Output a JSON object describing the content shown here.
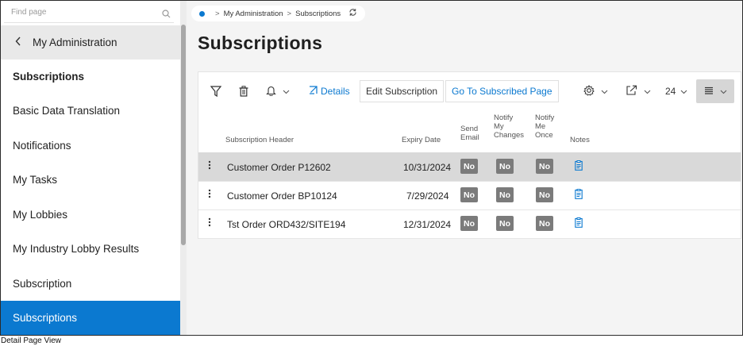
{
  "sidebar": {
    "search_placeholder": "Find page",
    "back_label": "My Administration",
    "items": [
      {
        "label": "Subscriptions"
      },
      {
        "label": "Basic Data Translation"
      },
      {
        "label": "Notifications"
      },
      {
        "label": "My Tasks"
      },
      {
        "label": "My Lobbies"
      },
      {
        "label": "My Industry Lobby Results"
      },
      {
        "label": "Subscription"
      },
      {
        "label": "Subscriptions"
      }
    ]
  },
  "breadcrumb": {
    "items": [
      "My Administration",
      "Subscriptions"
    ]
  },
  "page_title": "Subscriptions",
  "toolbar": {
    "details_label": "Details",
    "edit_label": "Edit Subscription",
    "goto_label": "Go To Subscribed Page",
    "page_size": "24"
  },
  "columns": {
    "header": "Subscription Header",
    "expiry": "Expiry Date",
    "send_email": [
      "Send",
      "Email"
    ],
    "notify_changes": [
      "Notify",
      "My",
      "Changes"
    ],
    "notify_once": [
      "Notify",
      "Me",
      "Once"
    ],
    "notes": "Notes"
  },
  "rows": [
    {
      "header": "Customer Order P12602",
      "expiry": "10/31/2024",
      "send_email": "No",
      "notify_changes": "No",
      "notify_once": "No"
    },
    {
      "header": "Customer Order BP10124",
      "expiry": "7/29/2024",
      "send_email": "No",
      "notify_changes": "No",
      "notify_once": "No"
    },
    {
      "header": "Tst Order ORD432/SITE194",
      "expiry": "12/31/2024",
      "send_email": "No",
      "notify_changes": "No",
      "notify_once": "No"
    }
  ],
  "caption": "Detail Page View",
  "colors": {
    "accent": "#0b79d0",
    "pill": "#7b7b7b",
    "selected_row": "#d9d9d9"
  }
}
